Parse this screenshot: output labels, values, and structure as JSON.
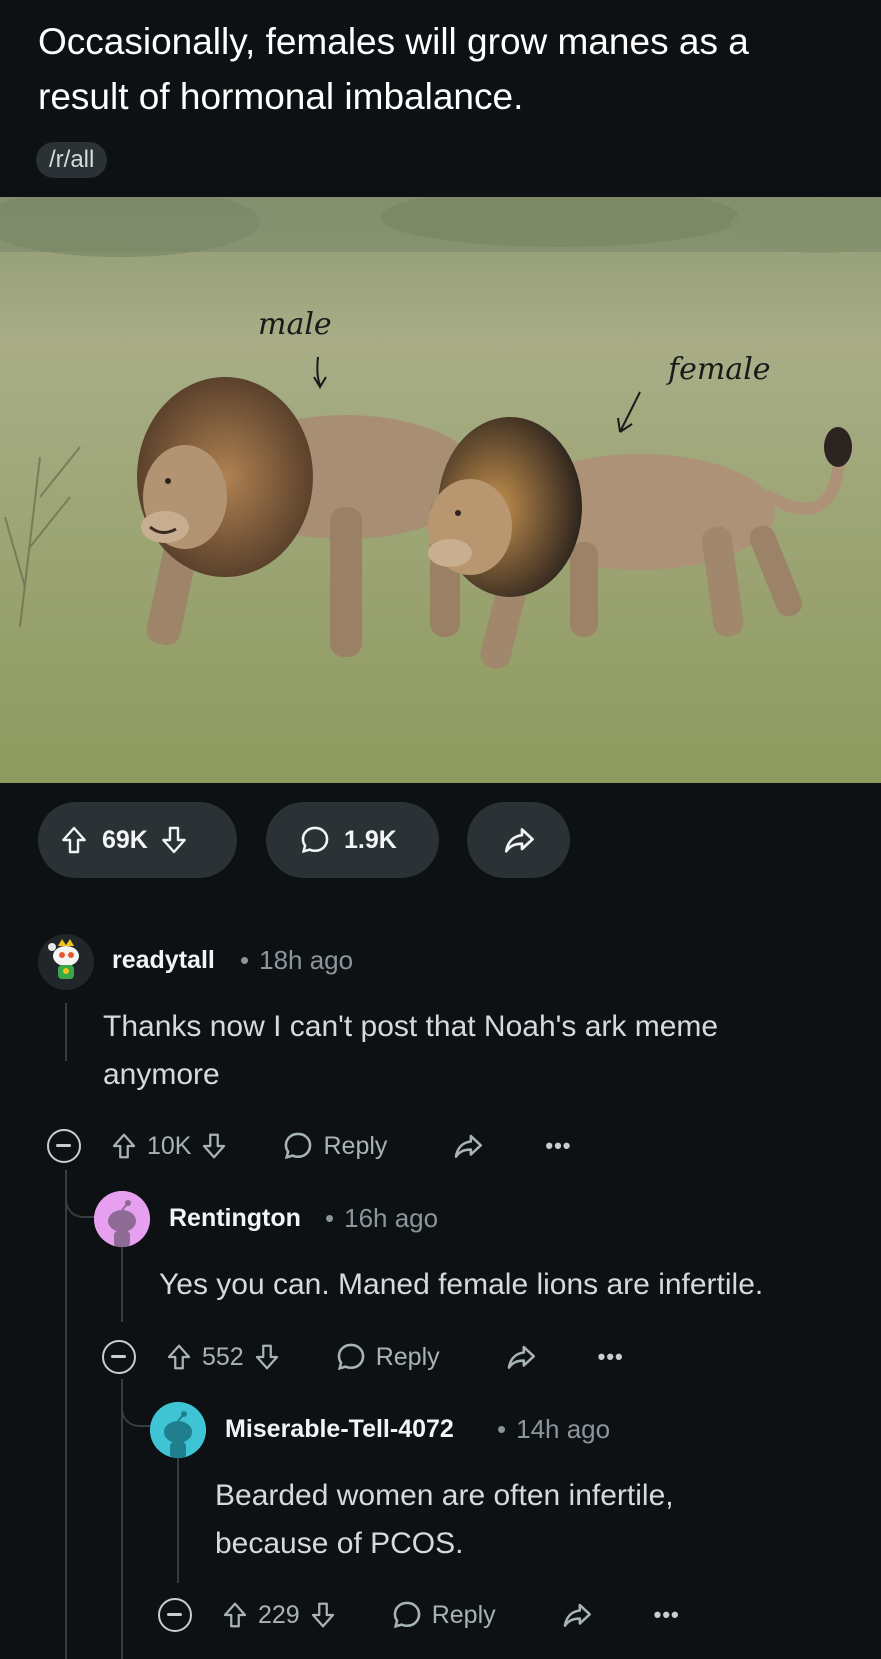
{
  "post": {
    "title": "Occasionally, females will grow manes as a result of hormonal imbalance.",
    "subreddit": "/r/all",
    "image": {
      "annotations": {
        "male": "male",
        "female": "female"
      }
    },
    "actions": {
      "votes": "69K",
      "comments": "1.9K"
    }
  },
  "comments": [
    {
      "user": "readytall",
      "time": "18h ago",
      "text": "Thanks now I can't post that Noah's ark meme anymore",
      "votes": "10K",
      "reply_label": "Reply",
      "avatar_color": "#1a1f22"
    },
    {
      "user": "Rentington",
      "time": "16h ago",
      "text": "Yes you can. Maned female lions are infertile.",
      "votes": "552",
      "reply_label": "Reply",
      "avatar_color": "#e7a0ef"
    },
    {
      "user": "Miserable-Tell-4072",
      "time": "14h ago",
      "text": "Bearded women are often infertile, because of PCOS.",
      "votes": "229",
      "reply_label": "Reply",
      "avatar_color": "#3fc4d6"
    }
  ],
  "meta_separator": "•",
  "more_label": "•••"
}
